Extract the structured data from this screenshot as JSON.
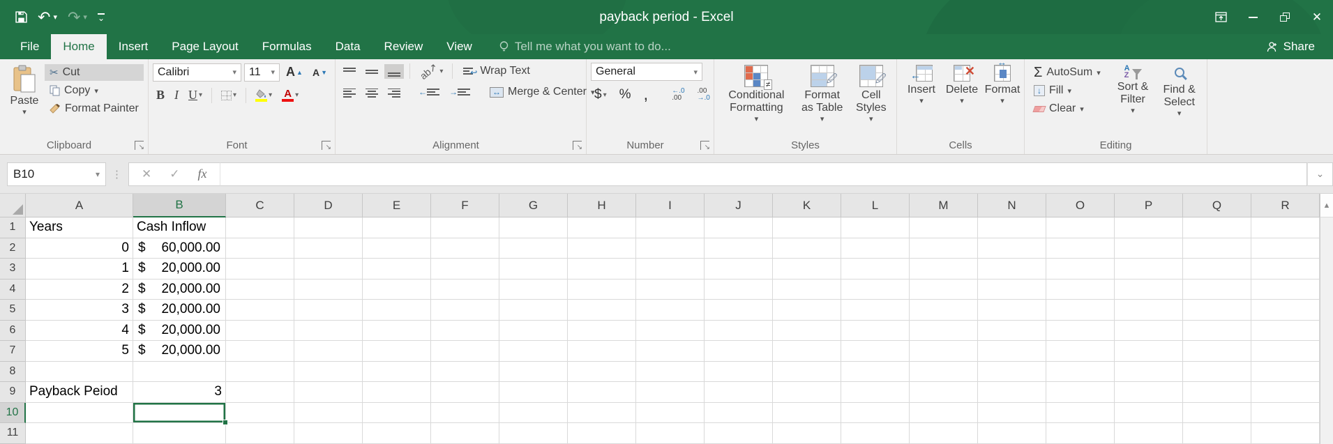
{
  "titlebar": {
    "title": "payback period - Excel"
  },
  "tabs": [
    {
      "label": "File"
    },
    {
      "label": "Home"
    },
    {
      "label": "Insert"
    },
    {
      "label": "Page Layout"
    },
    {
      "label": "Formulas"
    },
    {
      "label": "Data"
    },
    {
      "label": "Review"
    },
    {
      "label": "View"
    }
  ],
  "tellme": {
    "label": "Tell me what you want to do..."
  },
  "share": {
    "label": "Share"
  },
  "icons": {
    "dropdown": "▾",
    "undo": "↶",
    "redo": "↷",
    "close": "✕",
    "scissors": "✂",
    "check": "✓",
    "cancel": "✕",
    "fx": "fx",
    "chevron_down": "⌄",
    "dots": "⋮",
    "bold": "B",
    "italic": "I",
    "underline": "U",
    "letter_a": "A",
    "caret_up": "▲",
    "caret_down": "▼",
    "triangle_up": "▲",
    "dollar": "$",
    "percent": "%",
    "comma": ",",
    "dec_inc_top": "←.0",
    "dec_inc_bot": ".00",
    "dec_dec_top": ".00",
    "dec_dec_bot": "→.0",
    "orientation": "ab↗",
    "wrap_return": "↩",
    "merge_arrows": "↔",
    "indent_left": "←",
    "indent_right": "→",
    "sigma": "Σ",
    "fill_arrow": "↓",
    "sort_a": "A",
    "sort_z": "Z",
    "not_equal": "≠",
    "brush": "🖉",
    "delete_x": "✕",
    "insert_arrow": "←",
    "format_arrows": "↔",
    "launcher_arrow": "↘"
  },
  "ribbon": {
    "clipboard": {
      "label": "Clipboard",
      "paste": "Paste",
      "cut": "Cut",
      "copy": "Copy",
      "format_painter": "Format Painter"
    },
    "font": {
      "label": "Font",
      "family": "Calibri",
      "size": "11"
    },
    "alignment": {
      "label": "Alignment",
      "wrap": "Wrap Text",
      "merge": "Merge & Center"
    },
    "number": {
      "label": "Number",
      "format": "General"
    },
    "styles": {
      "label": "Styles",
      "conditional": "Conditional Formatting",
      "format_table": "Format as Table",
      "cell_styles": "Cell Styles"
    },
    "cells": {
      "label": "Cells",
      "insert": "Insert",
      "delete": "Delete",
      "format": "Format"
    },
    "editing": {
      "label": "Editing",
      "autosum": "AutoSum",
      "fill": "Fill",
      "clear": "Clear",
      "sort": "Sort & Filter",
      "find": "Find & Select"
    }
  },
  "formula_bar": {
    "name_box": "B10",
    "formula": ""
  },
  "grid": {
    "columns": [
      "A",
      "B",
      "C",
      "D",
      "E",
      "F",
      "G",
      "H",
      "I",
      "J",
      "K",
      "L",
      "M",
      "N",
      "O",
      "P",
      "Q",
      "R"
    ],
    "col_widths": {
      "gutter": 37,
      "A": 154,
      "B": 133,
      "default": 98
    },
    "selected": {
      "cell": "B10",
      "col": "B",
      "row": 10
    },
    "rows": [
      {
        "n": 1,
        "cells": {
          "A": {
            "v": "Years",
            "align": "left"
          },
          "B": {
            "v": "Cash Inflow",
            "align": "left"
          }
        }
      },
      {
        "n": 2,
        "cells": {
          "A": {
            "v": "0",
            "align": "right"
          },
          "B": {
            "fmt": "accounting",
            "cur": "$",
            "v": "60,000.00"
          }
        }
      },
      {
        "n": 3,
        "cells": {
          "A": {
            "v": "1",
            "align": "right"
          },
          "B": {
            "fmt": "accounting",
            "cur": "$",
            "v": "20,000.00"
          }
        }
      },
      {
        "n": 4,
        "cells": {
          "A": {
            "v": "2",
            "align": "right"
          },
          "B": {
            "fmt": "accounting",
            "cur": "$",
            "v": "20,000.00"
          }
        }
      },
      {
        "n": 5,
        "cells": {
          "A": {
            "v": "3",
            "align": "right"
          },
          "B": {
            "fmt": "accounting",
            "cur": "$",
            "v": "20,000.00"
          }
        }
      },
      {
        "n": 6,
        "cells": {
          "A": {
            "v": "4",
            "align": "right"
          },
          "B": {
            "fmt": "accounting",
            "cur": "$",
            "v": "20,000.00"
          }
        }
      },
      {
        "n": 7,
        "cells": {
          "A": {
            "v": "5",
            "align": "right"
          },
          "B": {
            "fmt": "accounting",
            "cur": "$",
            "v": "20,000.00"
          }
        }
      },
      {
        "n": 8,
        "cells": {}
      },
      {
        "n": 9,
        "cells": {
          "A": {
            "v": "Payback Peiod",
            "align": "left"
          },
          "B": {
            "v": "3",
            "align": "right"
          }
        }
      },
      {
        "n": 10,
        "cells": {}
      },
      {
        "n": 11,
        "cells": {}
      }
    ]
  },
  "colors": {
    "accent": "#217346",
    "fill_yellow": "#ffff00",
    "font_red": "#ee1111"
  }
}
